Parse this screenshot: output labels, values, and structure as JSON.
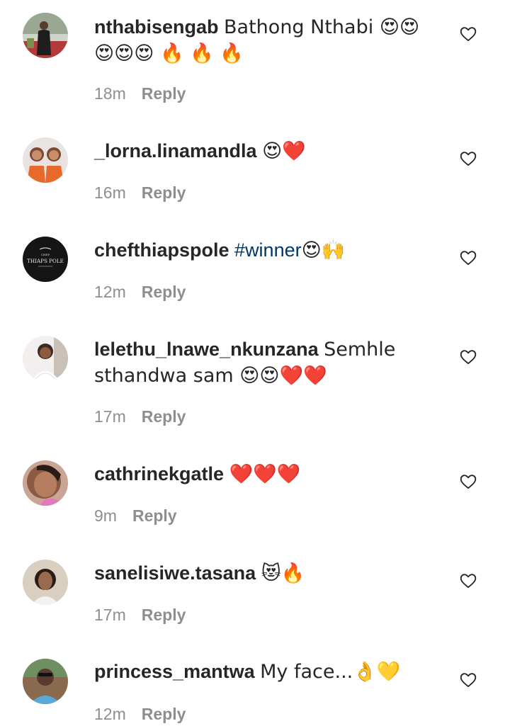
{
  "comments": [
    {
      "username": "nthabisengab",
      "text": "Bathong Nthabi 😍😍 😍😍😍 🔥 🔥 🔥",
      "time": "18m",
      "reply": "Reply"
    },
    {
      "username": "_lorna.linamandla",
      "text": "😍❤️",
      "time": "16m",
      "reply": "Reply"
    },
    {
      "username": "chefthiapspole",
      "text_before": "",
      "hashtag": "#winner",
      "text": "😍🙌",
      "time": "12m",
      "reply": "Reply",
      "avatar_text": {
        "top": "CHEF",
        "main": "THIAPS POLE"
      }
    },
    {
      "username": "lelethu_lnawe_nkunzana",
      "text": "Semhle sthandwa sam 😍😍❤️❤️",
      "time": "17m",
      "reply": "Reply"
    },
    {
      "username": "cathrinekgatle",
      "text": "❤️❤️❤️",
      "time": "9m",
      "reply": "Reply"
    },
    {
      "username": "sanelisiwe.tasana",
      "text": "😻🔥",
      "time": "17m",
      "reply": "Reply"
    },
    {
      "username": "princess_mantwa",
      "text": "My face...👌💛",
      "time": "12m",
      "reply": "Reply"
    }
  ],
  "colors": {
    "text": "#262626",
    "meta": "#8e8e8e",
    "hashtag": "#00376b"
  },
  "icons": {
    "like": "heart-outline-icon"
  }
}
